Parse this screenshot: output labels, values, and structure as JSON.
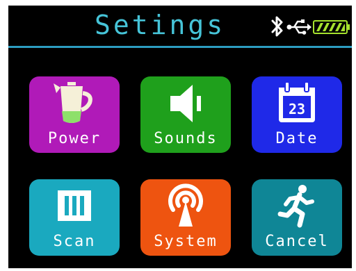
{
  "header": {
    "title": "Setings",
    "status_icons": [
      "bluetooth-icon",
      "usb-icon",
      "battery-icon"
    ]
  },
  "menu": {
    "tiles": [
      {
        "label": "Power",
        "icon": "power-cup-icon",
        "color": "#b01ab8"
      },
      {
        "label": "Sounds",
        "icon": "speaker-icon",
        "color": "#1fa01c"
      },
      {
        "label": "Date",
        "icon": "calendar-icon",
        "color": "#1f29e8",
        "icon_text": "23"
      },
      {
        "label": "Scan",
        "icon": "scan-grid-icon",
        "color": "#1aa9bf"
      },
      {
        "label": "System",
        "icon": "broadcast-icon",
        "color": "#ee5410"
      },
      {
        "label": "Cancel",
        "icon": "running-man-icon",
        "color": "#0f8696"
      }
    ]
  },
  "colors": {
    "title": "#46c4d8",
    "header_line": "#2c9cc0",
    "background": "#000000",
    "battery": "#a6e22e"
  }
}
